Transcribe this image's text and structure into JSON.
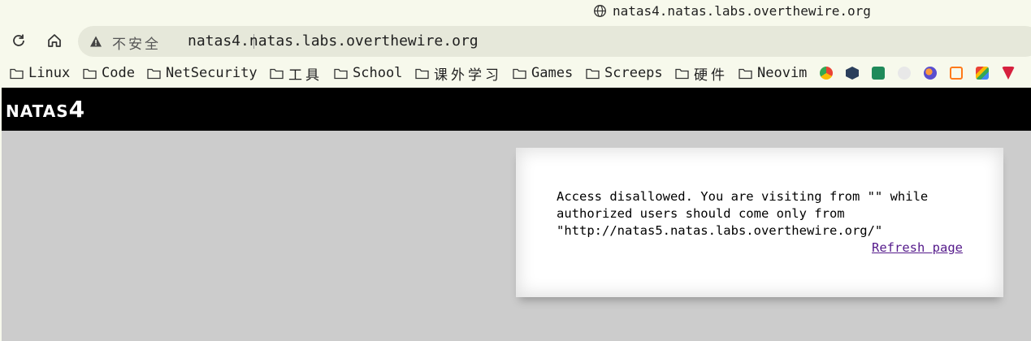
{
  "window": {
    "title": "natas4.natas.labs.overthewire.org",
    "title_icon": "globe-icon"
  },
  "toolbar": {
    "reload_icon": "reload-icon",
    "home_icon": "home-icon",
    "security_icon": "warning-icon",
    "security_label": "不安全",
    "url": "natas4.natas.labs.overthewire.org"
  },
  "bookmarks": {
    "folders": [
      "Linux",
      "Code",
      "NetSecurity",
      "工具",
      "School",
      "课外学习",
      "Games",
      "Screeps",
      "硬件",
      "Neovim"
    ],
    "favicons": [
      "chromium-favicon",
      "hex-favicon",
      "green-favicon",
      "gray-favicon",
      "firefox-favicon",
      "orange-favicon",
      "gmail-favicon",
      "red-favicon"
    ]
  },
  "page": {
    "header_small": "NATAS",
    "header_big": "4",
    "message": "Access disallowed. You are visiting from \"\" while authorized users should come only from \"http://natas5.natas.labs.overthewire.org/\"",
    "refresh_label": "Refresh page",
    "colors": {
      "header_bg": "#000000",
      "page_bg": "#cccccc",
      "link": "#551a8b"
    }
  }
}
